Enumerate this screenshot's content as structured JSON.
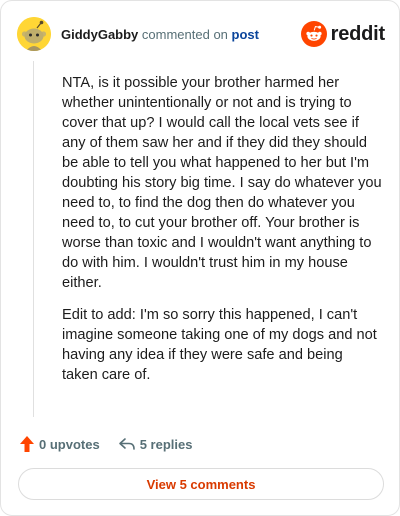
{
  "header": {
    "username": "GiddyGabby",
    "action_text": "commented on",
    "post_link": "post",
    "brand": "reddit"
  },
  "comment": {
    "paragraphs": [
      "NTA, is it possible your brother harmed her whether unintentionally or not and is trying to cover that up? I would call the local vets see if any of them saw her and if they did they should be able to tell you what happened to her but I'm doubting his story big time. I say do whatever you need to, to find the dog then do whatever you need to, to cut your brother off. Your brother is worse than toxic and I wouldn't want anything to do with him. I wouldn't trust him in my house either.",
      "Edit to add: I'm so sorry this happened, I can't imagine someone taking one of my dogs and not having any idea if they were safe and being taken care of."
    ]
  },
  "actions": {
    "upvotes": "0 upvotes",
    "replies": "5 replies"
  },
  "footer": {
    "view_comments": "View 5 comments"
  },
  "colors": {
    "brand_orange": "#ff4500",
    "link_blue": "#0a449b",
    "button_text": "#d93a00",
    "muted": "#576f76"
  },
  "icons": {
    "avatar": "snoo-avatar-icon",
    "logo": "reddit-logo-icon",
    "upvote": "upvote-arrow-icon",
    "reply": "reply-arrow-icon"
  }
}
